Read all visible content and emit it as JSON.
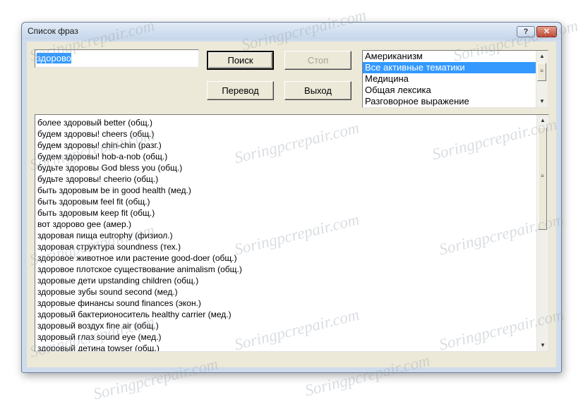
{
  "window": {
    "title": "Список фраз",
    "help_glyph": "?",
    "close_glyph": "✕"
  },
  "search": {
    "value": "здорово"
  },
  "buttons": {
    "search": "Поиск",
    "stop": "Стоп",
    "translate": "Перевод",
    "exit": "Выход"
  },
  "themes": {
    "items": [
      "Американизм",
      "Все активные тематики",
      "Медицина",
      "Общая лексика",
      "Разговорное выражение"
    ],
    "selected": "Все активные тематики"
  },
  "phrases": [
    "более здоровый better (общ.)",
    "будем здоровы! cheers (общ.)",
    "будем здоровы! chin-chin (разг.)",
    "будем здоровы! hob-a-nob (общ.)",
    "будьте здоровы God bless you (общ.)",
    "будьте здоровы! cheerio (общ.)",
    "быть здоровым be in good health (мед.)",
    "быть здоровым feel fit (общ.)",
    "быть здоровым keep fit (общ.)",
    "вот здорово gee (амер.)",
    "здоровая пища eutrophy (физиол.)",
    "здоровая структура soundness (тех.)",
    "здоровое животное или растение good-doer (общ.)",
    "здоровое плотское существование animalism (общ.)",
    "здоровые дети upstanding children (общ.)",
    "здоровые зубы sound second (мед.)",
    "здоровые финансы sound finances (экон.)",
    "здоровый бактерионоситель healthy carrier (мед.)",
    "здоровый воздух fine air (общ.)",
    "здоровый глаз sound eye (мед.)",
    "здоровый детина towser (общ.)"
  ],
  "scrollbar": {
    "up_glyph": "▲",
    "down_glyph": "▼",
    "grip_glyph": "≡"
  },
  "watermark": "Soringpcrepair.com"
}
